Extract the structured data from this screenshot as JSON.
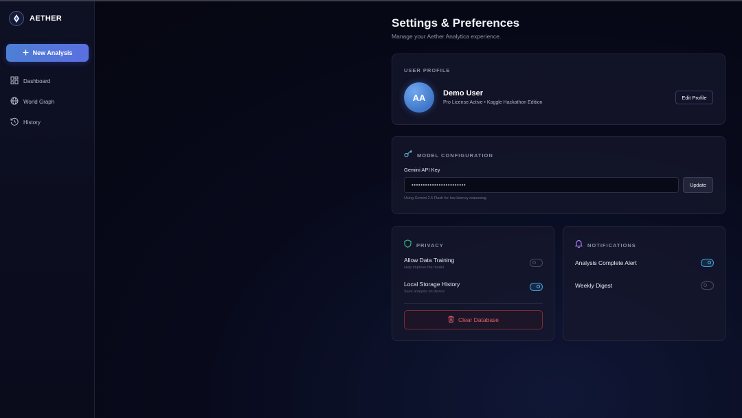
{
  "app": {
    "name": "AETHER"
  },
  "sidebar": {
    "new_analysis": "New Analysis",
    "items": [
      {
        "label": "Dashboard",
        "icon": "dashboard-icon"
      },
      {
        "label": "World Graph",
        "icon": "globe-icon"
      },
      {
        "label": "History",
        "icon": "history-icon"
      }
    ]
  },
  "page": {
    "title": "Settings & Preferences",
    "subtitle": "Manage your Aether Analytica experience."
  },
  "profile": {
    "section_label": "USER PROFILE",
    "initials": "AA",
    "name": "Demo User",
    "meta": "Pro License Active • Kaggle Hackathon Edition",
    "edit_label": "Edit Profile"
  },
  "model": {
    "section_label": "MODEL CONFIGURATION",
    "field_label": "Gemini API Key",
    "api_key_value": "••••••••••••••••••••••••",
    "update_label": "Update",
    "hint": "Using Gemini 2.5 Flash for low latency reasoning."
  },
  "privacy": {
    "section_label": "PRIVACY",
    "rows": [
      {
        "title": "Allow Data Training",
        "sub": "Help improve the model",
        "enabled": false
      },
      {
        "title": "Local Storage History",
        "sub": "Save analysis on device",
        "enabled": true
      }
    ],
    "clear_label": "Clear Database"
  },
  "notifications": {
    "section_label": "NOTIFICATIONS",
    "rows": [
      {
        "title": "Analysis Complete Alert",
        "enabled": true
      },
      {
        "title": "Weekly Digest",
        "enabled": false
      }
    ]
  },
  "colors": {
    "accent": "#4d7fd4",
    "toggle_on": "#3ea9e0",
    "danger": "#e2606a",
    "privacy_icon": "#3fb68b",
    "notif_icon": "#a77be8"
  }
}
